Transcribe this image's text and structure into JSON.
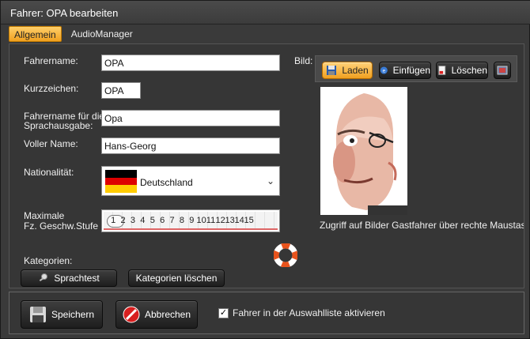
{
  "window": {
    "title": "Fahrer: OPA bearbeiten"
  },
  "tabs": [
    {
      "label": "Allgemein",
      "active": true
    },
    {
      "label": "AudioManager",
      "active": false
    }
  ],
  "form": {
    "fahrername_label": "Fahrername:",
    "fahrername_value": "OPA",
    "kurzzeichen_label": "Kurzzeichen:",
    "kurzzeichen_value": "OPA",
    "sprach_label_1": "Fahrername für die",
    "sprach_label_2": "Sprachausgabe:",
    "sprach_value": "Opa",
    "voller_name_label": "Voller Name:",
    "voller_name_value": "Hans-Georg",
    "nationalitaet_label": "Nationalität:",
    "nationalitaet_value": "Deutschland",
    "speed_label_1": "Maximale",
    "speed_label_2": "Fz. Geschw.Stufe",
    "speed_selected": 1,
    "speed_values": [
      "1",
      "2",
      "3",
      "4",
      "5",
      "6",
      "7",
      "8",
      "9",
      "10",
      "11",
      "12",
      "13",
      "14",
      "15"
    ],
    "kategorien_label": "Kategorien:"
  },
  "buttons": {
    "sprachtest": "Sprachtest",
    "kategorien_loeschen": "Kategorien löschen",
    "laden": "Laden",
    "einfuegen": "Einfügen",
    "loeschen": "Löschen",
    "speichern": "Speichern",
    "abbrechen": "Abbrechen"
  },
  "bild": {
    "label": "Bild:",
    "hint": "Zugriff auf Bilder Gastfahrer über rechte Maustaste (M"
  },
  "footer": {
    "checkbox_label": "Fahrer in der Auswahlliste aktivieren",
    "checkbox_checked": true
  },
  "colors": {
    "accent": "#f0a020",
    "background": "#3a3a3a",
    "flag_black": "#000000",
    "flag_red": "#dd0000",
    "flag_gold": "#ffcc00"
  }
}
